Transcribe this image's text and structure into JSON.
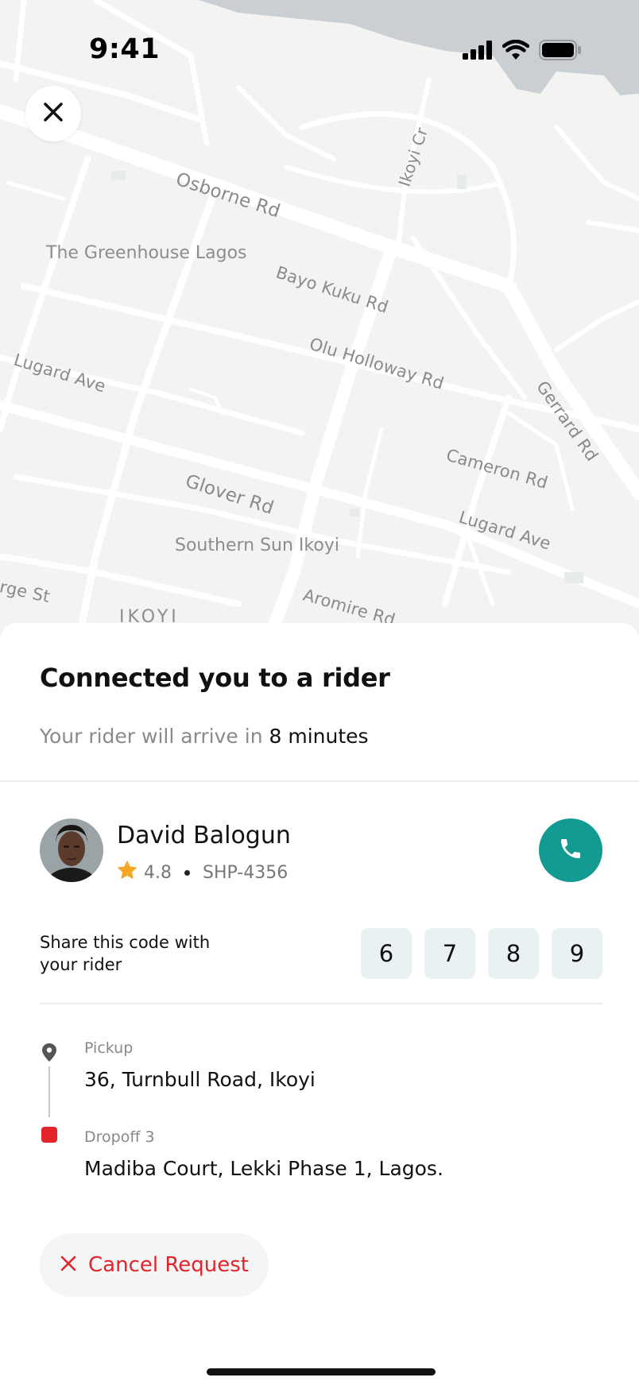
{
  "status_bar": {
    "time": "9:41"
  },
  "map": {
    "streets": [
      "Osborne Rd",
      "Bayo Kuku Rd",
      "Olu Holloway Rd",
      "Lugard Ave",
      "Glover Rd",
      "Cameron Rd",
      "Lugard Ave",
      "Aromire Rd",
      "Ikoyi Cr",
      "Gerrard Rd",
      "rge St"
    ],
    "pois": [
      "The Greenhouse Lagos",
      "Southern Sun Ikoyi",
      "IKOYI"
    ]
  },
  "sheet": {
    "title": "Connected you to a rider",
    "eta_prefix": "Your rider will arrive in ",
    "eta_value": "8 minutes"
  },
  "rider": {
    "name": "David Balogun",
    "rating": "4.8",
    "plate": "SHP-4356",
    "star_color": "#f5a623",
    "call_color": "#139b93"
  },
  "code": {
    "label": "Share this code with your rider",
    "digits": [
      "6",
      "7",
      "8",
      "9"
    ]
  },
  "route": {
    "pickup_label": "Pickup",
    "pickup_address": "36, Turnbull Road, Ikoyi",
    "dropoff_label": "Dropoff 3",
    "dropoff_address": "Madiba Court, Lekki Phase 1, Lagos."
  },
  "actions": {
    "cancel_label": "Cancel Request",
    "cancel_color": "#e3242b"
  }
}
